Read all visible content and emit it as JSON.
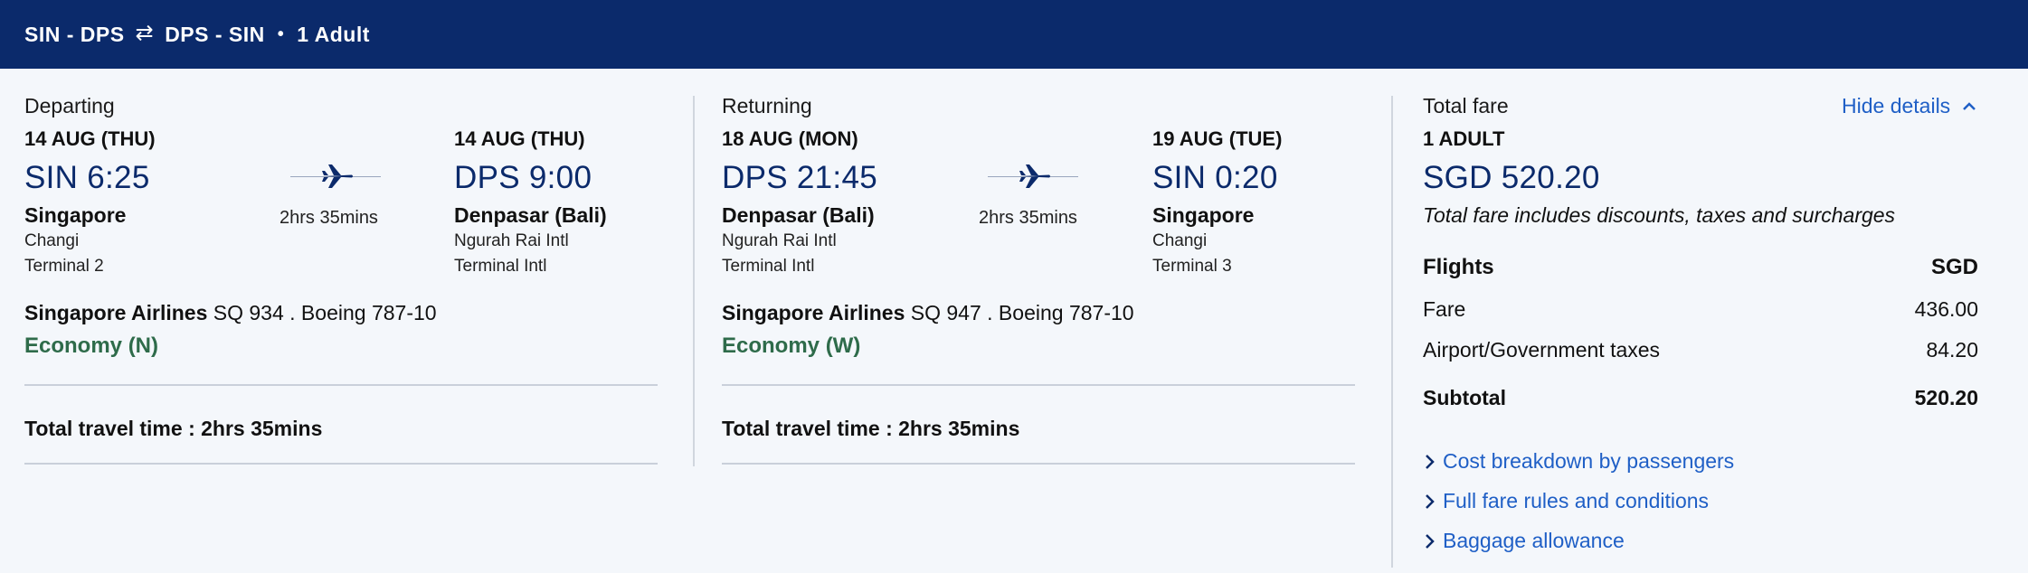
{
  "header": {
    "outbound": "SIN - DPS",
    "swap_icon": "⇄",
    "inbound": "DPS - SIN",
    "separator": "•",
    "passengers": "1 Adult"
  },
  "departing": {
    "section_label": "Departing",
    "dep_date": "14 AUG (THU)",
    "dep_time": "SIN 6:25",
    "dep_city": "Singapore",
    "dep_airport": "Changi",
    "dep_terminal": "Terminal 2",
    "duration": "2hrs 35mins",
    "arr_date": "14 AUG (THU)",
    "arr_time": "DPS 9:00",
    "arr_city": "Denpasar (Bali)",
    "arr_airport": "Ngurah Rai Intl",
    "arr_terminal": "Terminal Intl",
    "airline_name": "Singapore Airlines",
    "flight_info": "SQ 934 . Boeing 787-10",
    "cabin": "Economy (N)",
    "total_time_label": "Total travel time :",
    "total_time_value": "2hrs 35mins"
  },
  "returning": {
    "section_label": "Returning",
    "dep_date": "18 AUG (MON)",
    "dep_time": "DPS 21:45",
    "dep_city": "Denpasar (Bali)",
    "dep_airport": "Ngurah Rai Intl",
    "dep_terminal": "Terminal Intl",
    "duration": "2hrs 35mins",
    "arr_date": "19 AUG (TUE)",
    "arr_time": "SIN 0:20",
    "arr_city": "Singapore",
    "arr_airport": "Changi",
    "arr_terminal": "Terminal 3",
    "airline_name": "Singapore Airlines",
    "flight_info": "SQ 947 . Boeing 787-10",
    "cabin": "Economy (W)",
    "total_time_label": "Total travel time :",
    "total_time_value": "2hrs 35mins"
  },
  "fare": {
    "label": "Total fare",
    "hide_details": "Hide details",
    "pax_label": "1 ADULT",
    "total": "SGD 520.20",
    "note": "Total fare includes discounts, taxes and surcharges",
    "flights_label": "Flights",
    "currency": "SGD",
    "rows": [
      {
        "label": "Fare",
        "value": "436.00"
      },
      {
        "label": "Airport/Government taxes",
        "value": "84.20"
      }
    ],
    "subtotal_label": "Subtotal",
    "subtotal_value": "520.20",
    "links": [
      "Cost breakdown by passengers",
      "Full fare rules and conditions",
      "Baggage allowance"
    ]
  },
  "colors": {
    "header_bg": "#0b2a6b",
    "time_text": "#0b2a6b",
    "cabin_text": "#2e6b4a",
    "link_text": "#1f5fc6",
    "page_bg": "#f4f7fb"
  },
  "icons": {
    "plane": "airplane-icon",
    "chevron_up": "chevron-up-icon",
    "chevron_right": "chevron-right-icon"
  }
}
